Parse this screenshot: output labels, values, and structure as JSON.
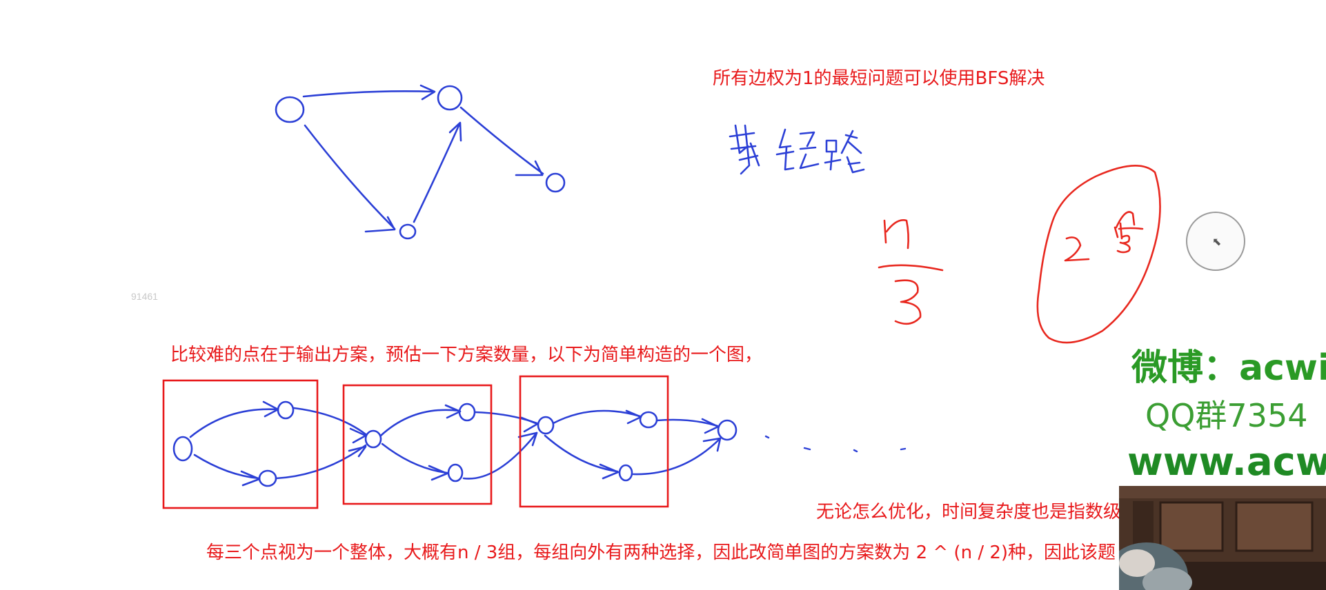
{
  "notes": {
    "bfs": "所有边权为1的最短问题可以使用BFS解决",
    "hard_point": "比较难的点在于输出方案，预估一下方案数量，以下为简单构造的一个图，",
    "optimize": "无论怎么优化，时间复杂度也是指数级别",
    "groups": "每三个点视为一个整体，大概有n / 3组，每组向外有两种选择，因此改简单图的方案数为 2 ^ (n / 2)种，因此该题"
  },
  "handwriting": {
    "shortest_path": "最短路",
    "fraction_numerator": "n",
    "fraction_denominator": "3",
    "power_base": "2",
    "power_exponent_numerator": "n",
    "power_exponent_denominator": "3"
  },
  "watermark": {
    "id": "91461",
    "weibo": "微博：acwin",
    "qq": "QQ群7354",
    "www": "www.acwin"
  },
  "colors": {
    "note_text": "#e8191b",
    "sketch_blue": "#2b3fd6",
    "sketch_red": "#e8281f",
    "watermark_green": "#2a9a25"
  },
  "icons": {
    "cursor": "pointer-cursor-icon"
  }
}
